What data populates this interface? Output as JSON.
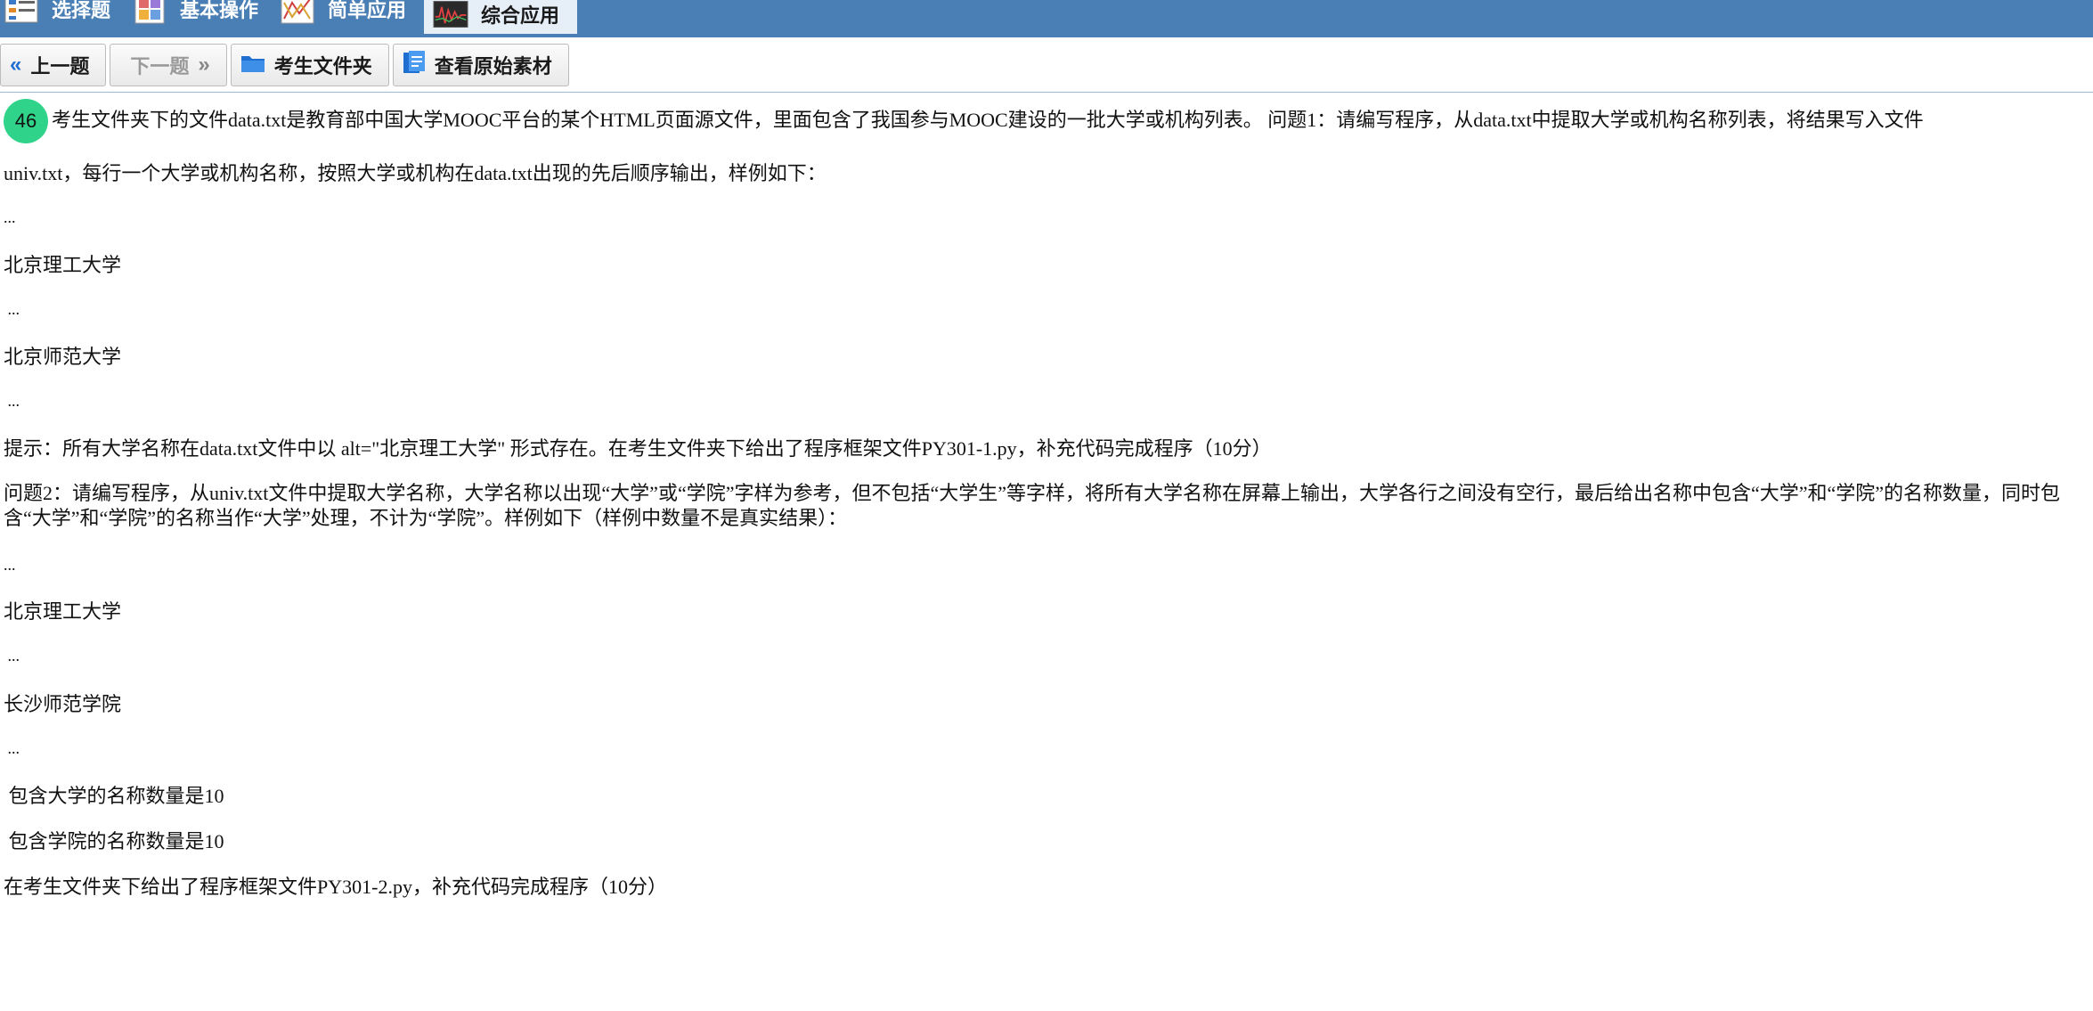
{
  "tabs": [
    {
      "label": "选择题",
      "icon": "list-icon",
      "active": false
    },
    {
      "label": "基本操作",
      "icon": "grid-icon",
      "active": false
    },
    {
      "label": "简单应用",
      "icon": "chart-icon",
      "active": false
    },
    {
      "label": "综合应用",
      "icon": "waveform-icon",
      "active": true
    }
  ],
  "toolbar": {
    "prev_label": "上一题",
    "next_label": "下一题",
    "folder_label": "考生文件夹",
    "view_label": "查看原始素材"
  },
  "question": {
    "number": "46",
    "line1": "考生文件夹下的文件data.txt是教育部中国大学MOOC平台的某个HTML页面源文件，里面包含了我国参与MOOC建设的一批大学或机构列表。 问题1：请编写程序，从data.txt中提取大学或机构名称列表，将结果写入文件",
    "line2": "univ.txt，每行一个大学或机构名称，按照大学或机构在data.txt出现的先后顺序输出，样例如下：",
    "ellipsis": "...",
    "ellipsis_indent": " ...",
    "sample1_a": "北京理工大学",
    "sample1_b": "北京师范大学",
    "hint1": "提示：所有大学名称在data.txt文件中以 alt=\"北京理工大学\" 形式存在。在考生文件夹下给出了程序框架文件PY301-1.py，补充代码完成程序（10分）",
    "q2": "问题2：请编写程序，从univ.txt文件中提取大学名称，大学名称以出现“大学”或“学院”字样为参考，但不包括“大学生”等字样，将所有大学名称在屏幕上输出，大学各行之间没有空行，最后给出名称中包含“大学”和“学院”的名称数量，同时包含“大学”和“学院”的名称当作“大学”处理，不计为“学院”。样例如下（样例中数量不是真实结果）：",
    "sample2_a": "北京理工大学",
    "sample2_b": "长沙师范学院",
    "count1": " 包含大学的名称数量是10",
    "count2": " 包含学院的名称数量是10",
    "hint2": "在考生文件夹下给出了程序框架文件PY301-2.py，补充代码完成程序（10分）"
  },
  "colors": {
    "tabbar": "#4a7fb5",
    "badge": "#2fd48a",
    "accent_icon": "#1f6fd1"
  }
}
